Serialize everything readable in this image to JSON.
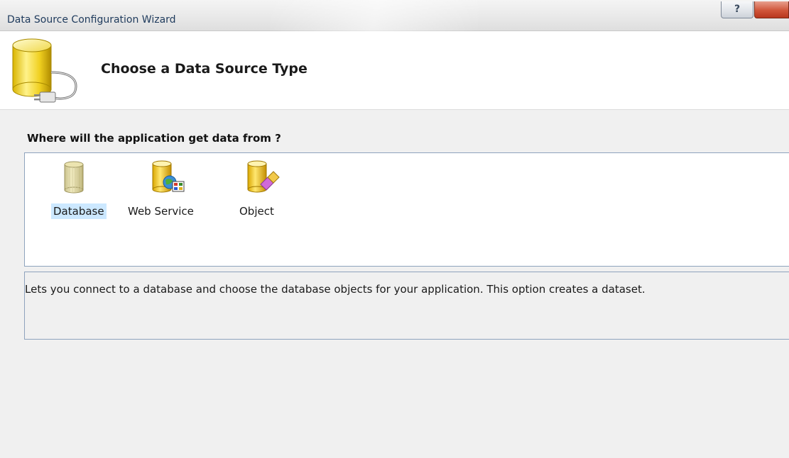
{
  "window": {
    "title": "Data Source Configuration Wizard",
    "help_label": "?"
  },
  "header": {
    "title": "Choose a Data Source Type",
    "icon": "database-plug-icon"
  },
  "question": "Where will the application get data from ?",
  "sources": [
    {
      "label": "Database",
      "icon": "database-icon",
      "selected": true
    },
    {
      "label": "Web Service",
      "icon": "web-service-icon",
      "selected": false
    },
    {
      "label": "Object",
      "icon": "object-icon",
      "selected": false
    }
  ],
  "description": "Lets you connect to a database and choose the database objects for your application. This option creates a dataset.",
  "colors": {
    "selection": "#cce8ff",
    "border": "#8ea3bd",
    "close_button": "#c8472c"
  }
}
